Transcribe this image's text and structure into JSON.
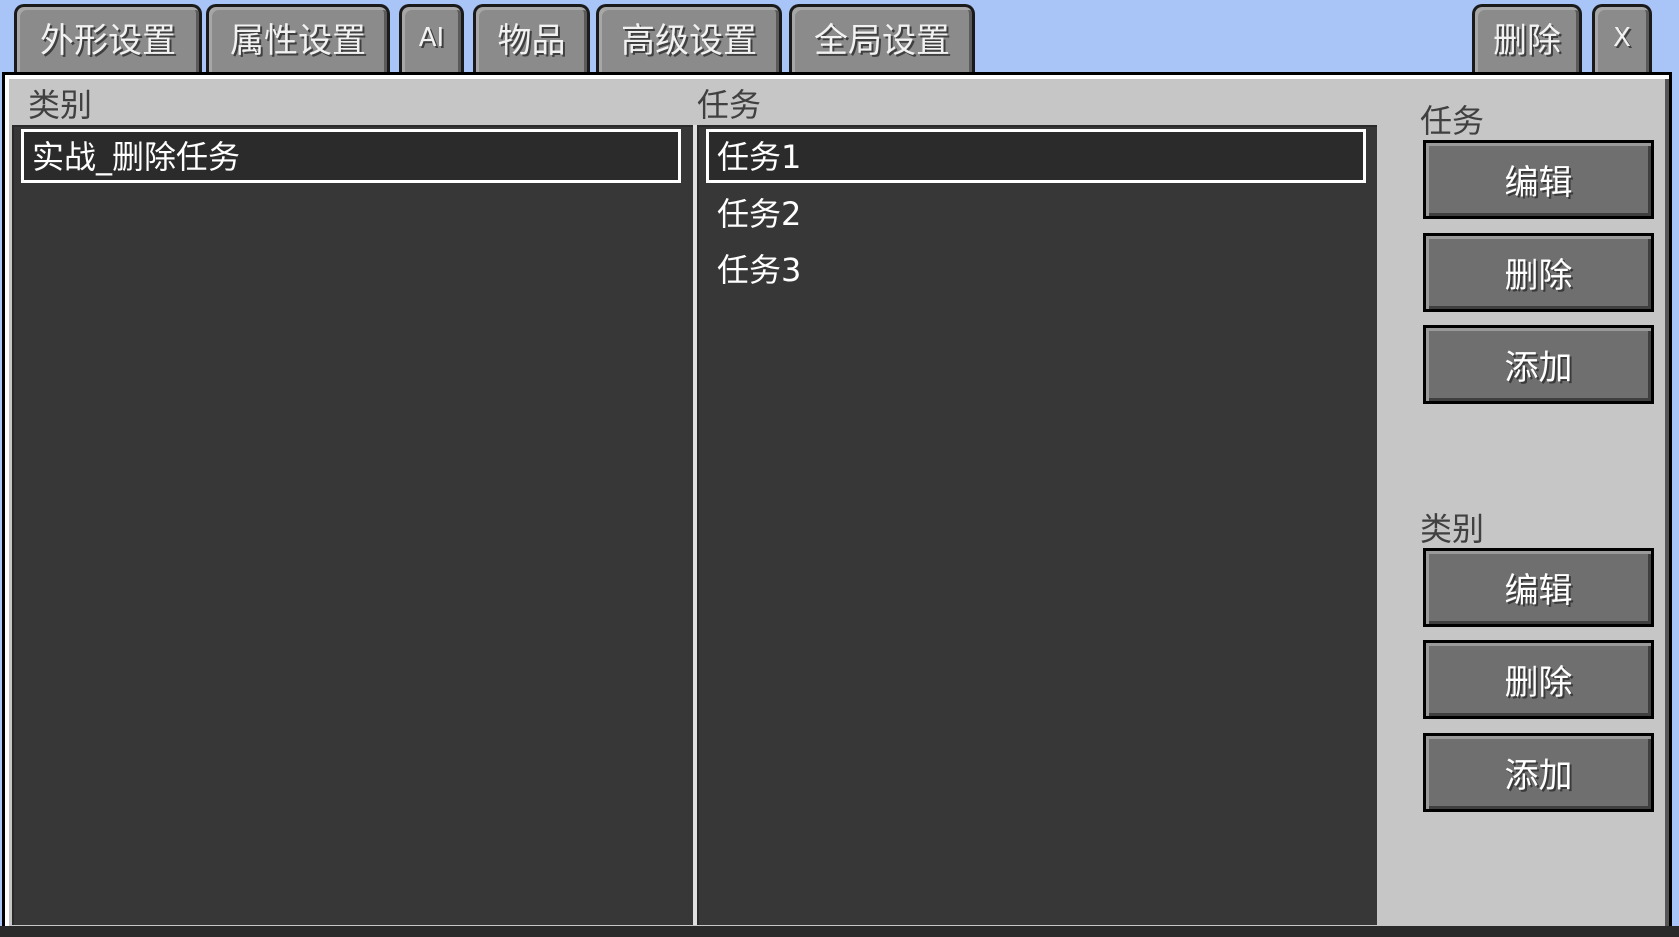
{
  "tabs": [
    {
      "label": "外形设置"
    },
    {
      "label": "属性设置"
    },
    {
      "label": "AI"
    },
    {
      "label": "物品"
    },
    {
      "label": "高级设置"
    },
    {
      "label": "全局设置"
    }
  ],
  "header_actions": {
    "delete_label": "删除",
    "close_label": "X"
  },
  "category_column": {
    "header": "类别",
    "items": [
      {
        "label": "实战_删除任务",
        "selected": true
      }
    ]
  },
  "quest_column": {
    "header": "任务",
    "items": [
      {
        "label": "任务1",
        "selected": true
      },
      {
        "label": "任务2",
        "selected": false
      },
      {
        "label": "任务3",
        "selected": false
      }
    ]
  },
  "side_panel": {
    "quest_section": {
      "title": "任务",
      "edit_label": "编辑",
      "delete_label": "删除",
      "add_label": "添加"
    },
    "category_section": {
      "title": "类别",
      "edit_label": "编辑",
      "delete_label": "删除",
      "add_label": "添加"
    }
  },
  "colors": {
    "sky": "#a9c4f7",
    "panel_bg": "#c6c6c6",
    "list_bg": "#373737",
    "button_bg": "#6f6f6f",
    "tab_bg": "#8b8b8b"
  }
}
